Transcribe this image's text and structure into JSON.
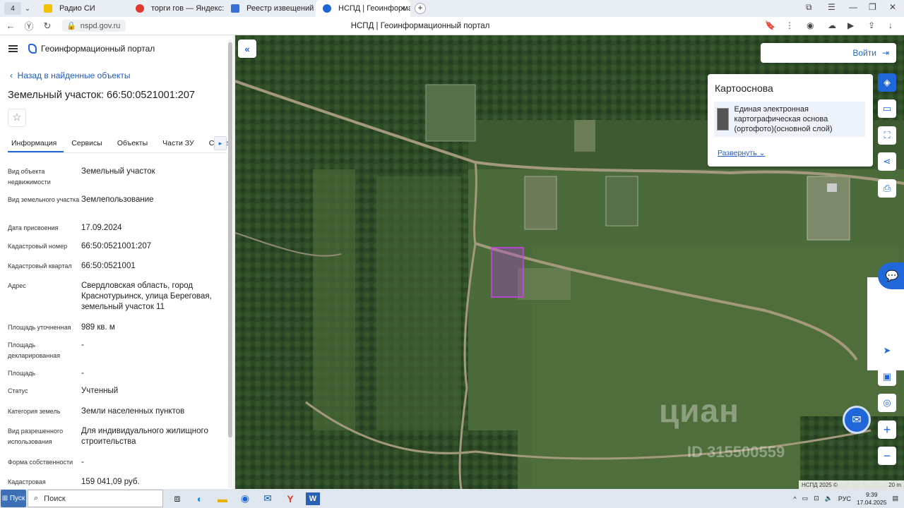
{
  "browser": {
    "tabs": [
      {
        "label": "Радио СИ",
        "color": "#f2c200"
      },
      {
        "label": "торги гов — Яндекс: нашл",
        "color": "#e03a2f"
      },
      {
        "label": "Реестр извещений",
        "color": "#3a6fd8"
      },
      {
        "label": "НСПД | Геоинформацион",
        "color": "#1f66d9"
      }
    ],
    "tab_count": "4",
    "url": "nspd.gov.ru",
    "page_title": "НСПД | Геоинформационный портал"
  },
  "sidebar": {
    "portal_name": "Геоинформационный портал",
    "back_link": "Назад в найденные объекты",
    "title": "Земельный участок: 66:50:0521001:207",
    "tabs": [
      "Информация",
      "Сервисы",
      "Объекты",
      "Части ЗУ",
      "Соста"
    ],
    "fields": [
      {
        "key": "Вид объекта недвижимости",
        "value": "Земельный участок"
      },
      {
        "key": "Вид земельного участка",
        "value": "Землепользование"
      },
      {
        "key": "Дата присвоения",
        "value": "17.09.2024"
      },
      {
        "key": "Кадастровый номер",
        "value": "66:50:0521001:207"
      },
      {
        "key": "Кадастровый квартал",
        "value": "66:50:0521001"
      },
      {
        "key": "Адрес",
        "value": "Свердловская область, город Краснотурьинск, улица Береговая, земельный участок 11"
      },
      {
        "key": "Площадь уточненная",
        "value": "989 кв. м"
      },
      {
        "key": "Площадь декларированная",
        "value": "-"
      },
      {
        "key": "Площадь",
        "value": "-"
      },
      {
        "key": "Статус",
        "value": "Учтенный"
      },
      {
        "key": "Категория земель",
        "value": "Земли населенных пунктов"
      },
      {
        "key": "Вид разрешенного использования",
        "value": "Для индивидуального жилищного строительства"
      },
      {
        "key": "Форма собственности",
        "value": "-"
      },
      {
        "key": "Кадастровая",
        "value": "159 041,09 руб."
      }
    ]
  },
  "map": {
    "login_label": "Войти",
    "basemap_title": "Картооснова",
    "basemap_layer": "Единая электронная картографическая основа (ортофото)(основной слой)",
    "expand_label": "Развернуть",
    "scale_left": "НСПД 2025 ©",
    "scale_right": "20 m",
    "watermark_brand": "циан",
    "watermark_id": "ID 315500559"
  },
  "taskbar": {
    "start_label": "Пуск",
    "search_label": "Поиск",
    "lang": "РУС",
    "time": "9:39",
    "date": "17.04.2025"
  }
}
